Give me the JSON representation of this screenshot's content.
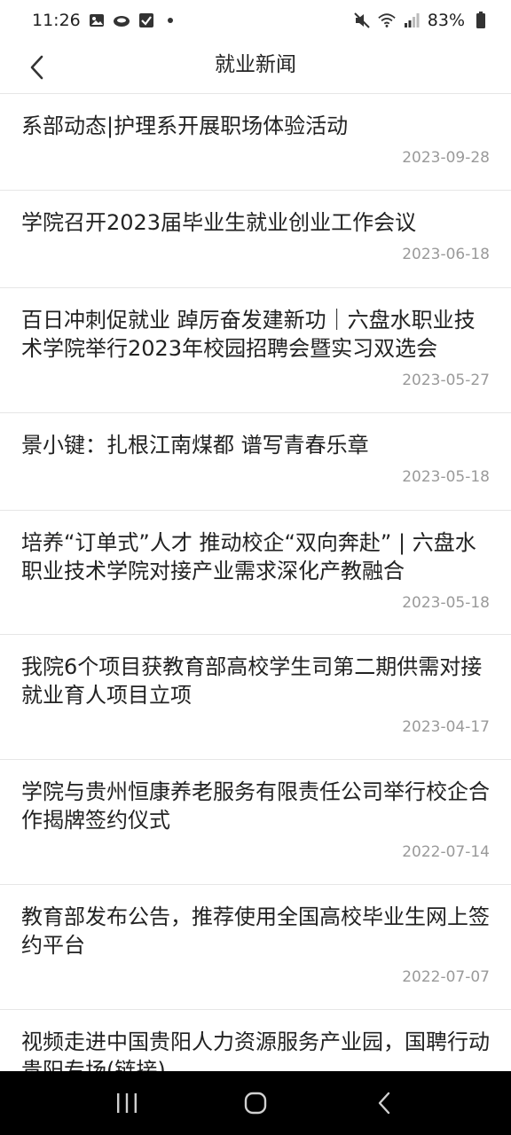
{
  "status_bar": {
    "time": "11:26",
    "battery": "83%",
    "left_icons": [
      "gallery-icon",
      "cloud-icon",
      "checkbox-icon",
      "notification-dot-icon"
    ],
    "right_icons": [
      "mute-icon",
      "wifi-icon",
      "signal-icon",
      "battery-icon"
    ]
  },
  "header": {
    "title": "就业新闻",
    "back_icon": "chevron-left-icon"
  },
  "news": [
    {
      "title": "系部动态|护理系开展职场体验活动",
      "date": "2023-09-28"
    },
    {
      "title": "学院召开2023届毕业生就业创业工作会议",
      "date": "2023-06-18"
    },
    {
      "title": "百日冲刺促就业 踔厉奋发建新功｜六盘水职业技术学院举行2023年校园招聘会暨实习双选会",
      "date": "2023-05-27"
    },
    {
      "title": "景小键：扎根江南煤都 谱写青春乐章",
      "date": "2023-05-18"
    },
    {
      "title": "培养“订单式”人才 推动校企“双向奔赴” | 六盘水职业技术学院对接产业需求深化产教融合",
      "date": "2023-05-18"
    },
    {
      "title": "我院6个项目获教育部高校学生司第二期供需对接就业育人项目立项",
      "date": "2023-04-17"
    },
    {
      "title": "学院与贵州恒康养老服务有限责任公司举行校企合作揭牌签约仪式",
      "date": "2022-07-14"
    },
    {
      "title": "教育部发布公告，推荐使用全国高校毕业生网上签约平台",
      "date": "2022-07-07"
    },
    {
      "title": "视频走进中国贵阳人力资源服务产业园，国聘行动贵阳专场(链接)",
      "date": ""
    }
  ],
  "nav_bar": {
    "icons": [
      "recent-apps-icon",
      "home-icon",
      "back-icon"
    ]
  },
  "colors": {
    "divider": "#e6e6e6",
    "date_text": "#9a9a9a",
    "nav_background": "#000000"
  }
}
